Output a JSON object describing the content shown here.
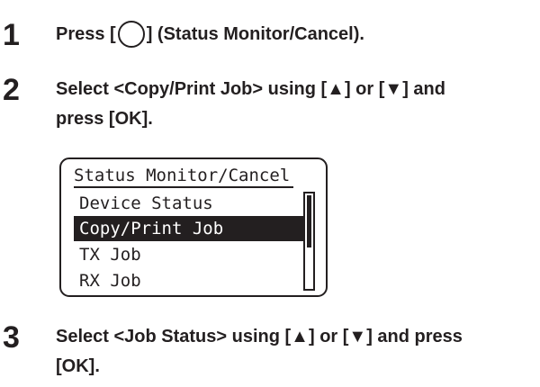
{
  "steps": [
    {
      "number": "1",
      "line1_before": "Press [",
      "line1_after": "] (Status Monitor/Cancel)."
    },
    {
      "number": "2",
      "line1": "Select <Copy/Print Job> using [▲] or [▼] and",
      "line2": "press [OK]."
    },
    {
      "number": "3",
      "line1": "Select <Job Status> using [▲] or [▼] and press",
      "line2": "[OK]."
    }
  ],
  "lcd": {
    "title": "Status Monitor/Cancel",
    "items": [
      {
        "label": "Device Status",
        "selected": false
      },
      {
        "label": "Copy/Print Job",
        "selected": true
      },
      {
        "label": "TX Job",
        "selected": false
      },
      {
        "label": "RX Job",
        "selected": false
      }
    ],
    "scrollbar_position": 0.0
  },
  "icons": {
    "status_monitor_button": "circle-button-icon"
  }
}
